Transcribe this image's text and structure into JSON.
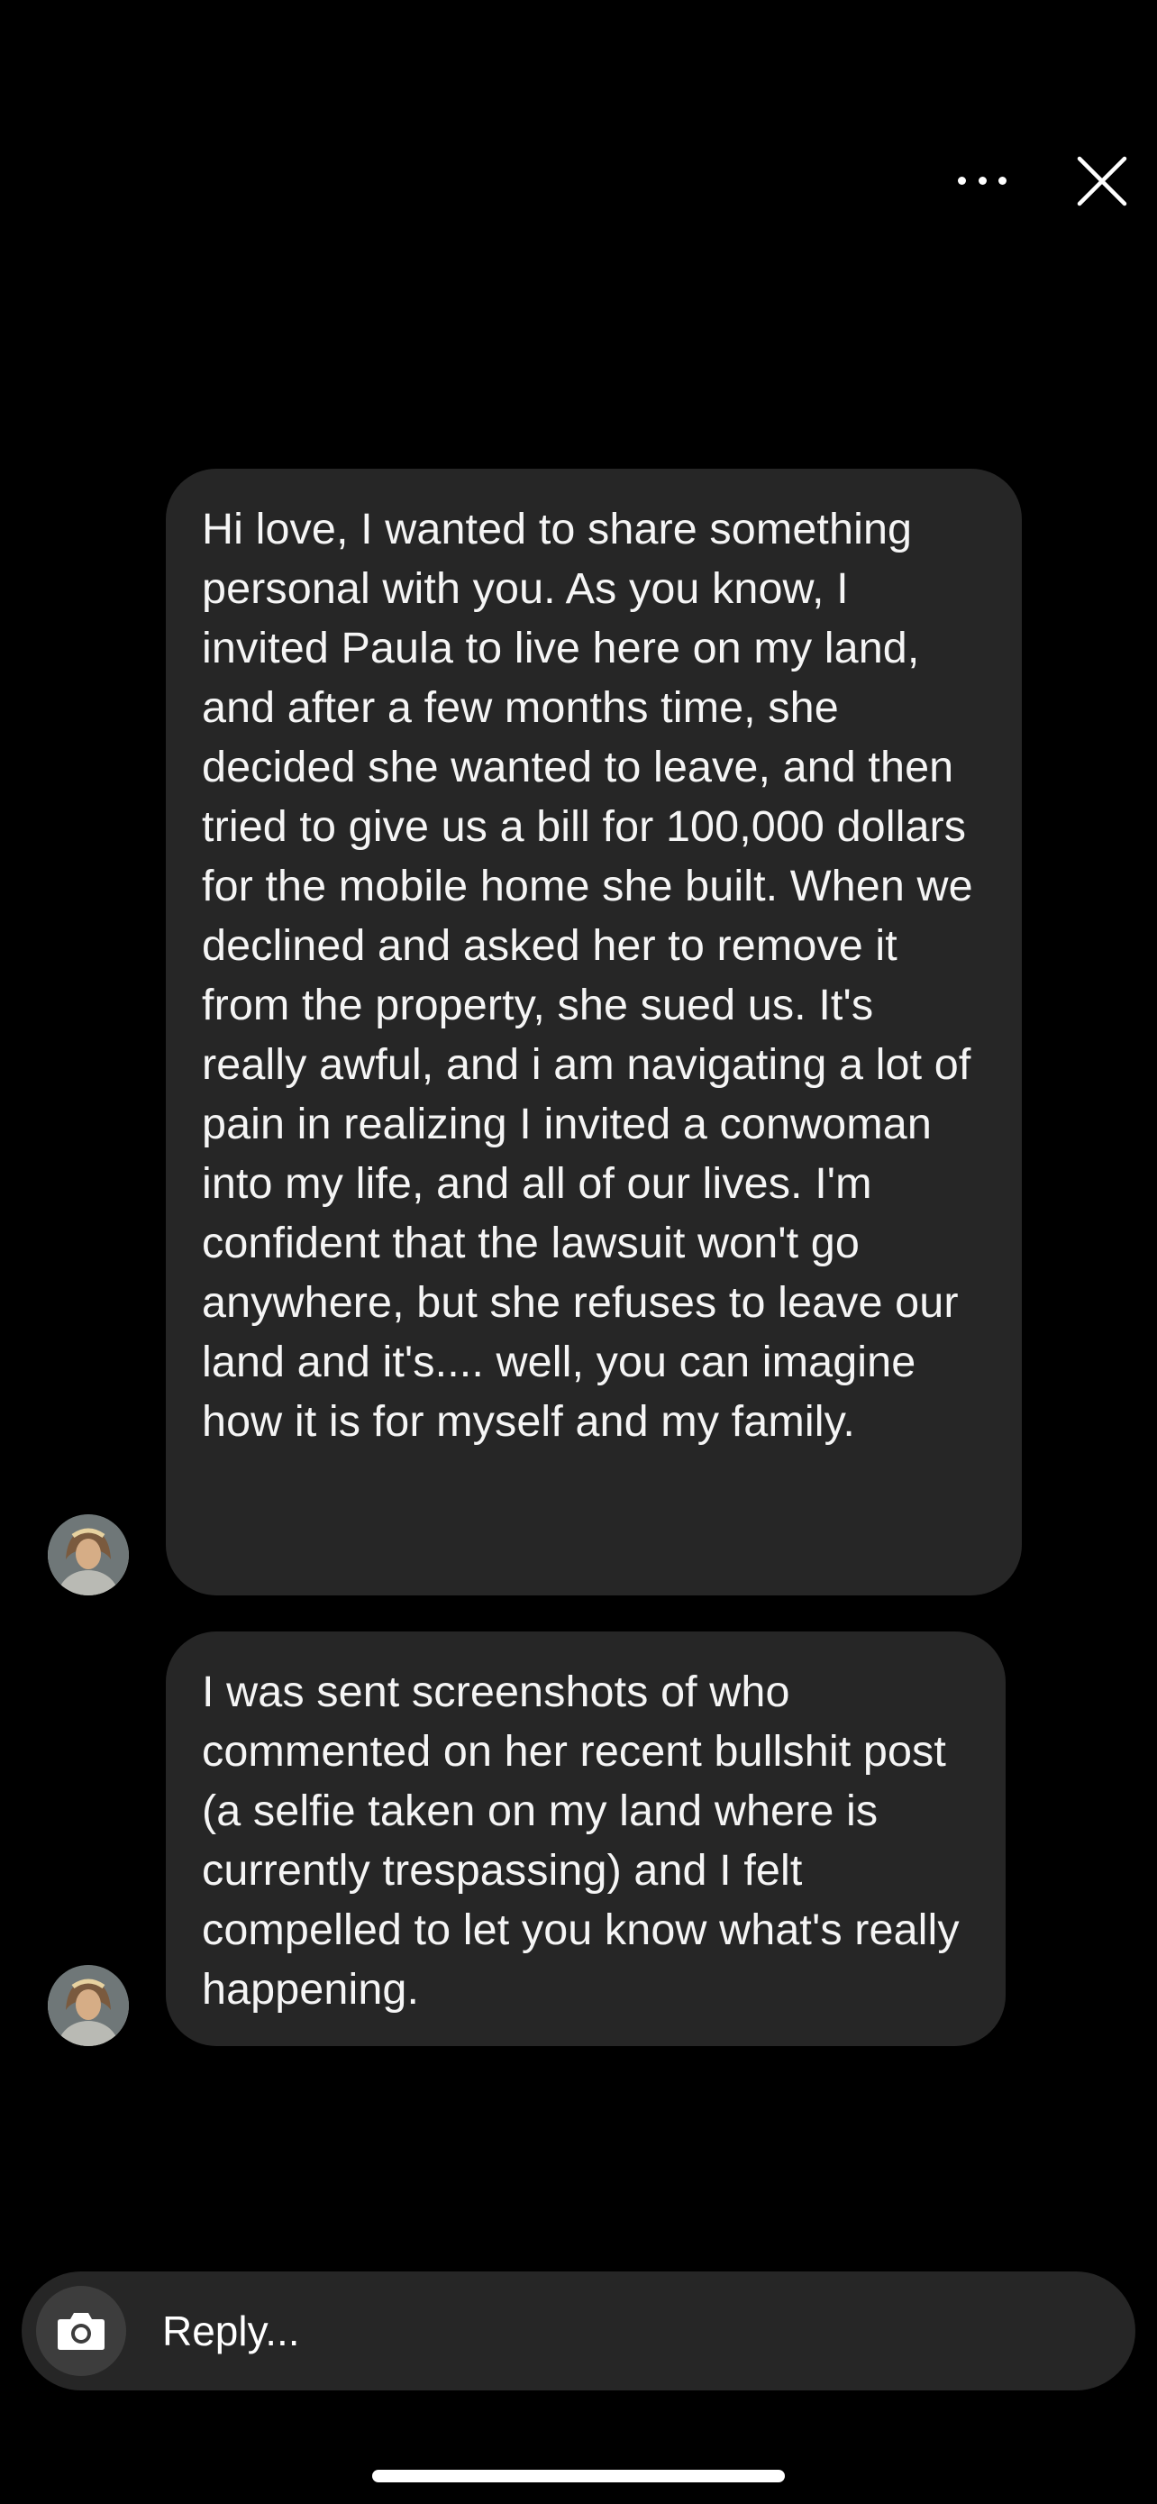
{
  "header": {
    "more_icon": "ellipsis-horizontal",
    "close_icon": "x-close"
  },
  "messages": [
    {
      "sender": "other",
      "avatar": "profile-photo",
      "text": "Hi love, I wanted to share something personal with you. As you know, I invited Paula to live here on my land, and after a few months time, she decided she wanted to leave, and then tried to give us a bill for 100,000 dollars for the mobile home she built. When we declined and asked her to remove it from the property, she sued us. It's really awful, and i am navigating a lot of pain in realizing I invited a conwoman into my life, and all of our lives. I'm confident that the lawsuit won't go anywhere, but she refuses to leave our land and it's.... well, you can imagine how it is for myself and my family."
    },
    {
      "sender": "other",
      "avatar": "profile-photo",
      "text": "I was sent screenshots of who commented on her recent bullshit post (a selfie taken on my land where is currently trespassing) and I felt compelled to let you know what's really happening."
    }
  ],
  "composer": {
    "camera_icon": "camera",
    "placeholder": "Reply..."
  },
  "colors": {
    "background": "#000000",
    "bubble": "#262626",
    "text": "#ffffff",
    "camera_button": "#3d3d3d"
  }
}
